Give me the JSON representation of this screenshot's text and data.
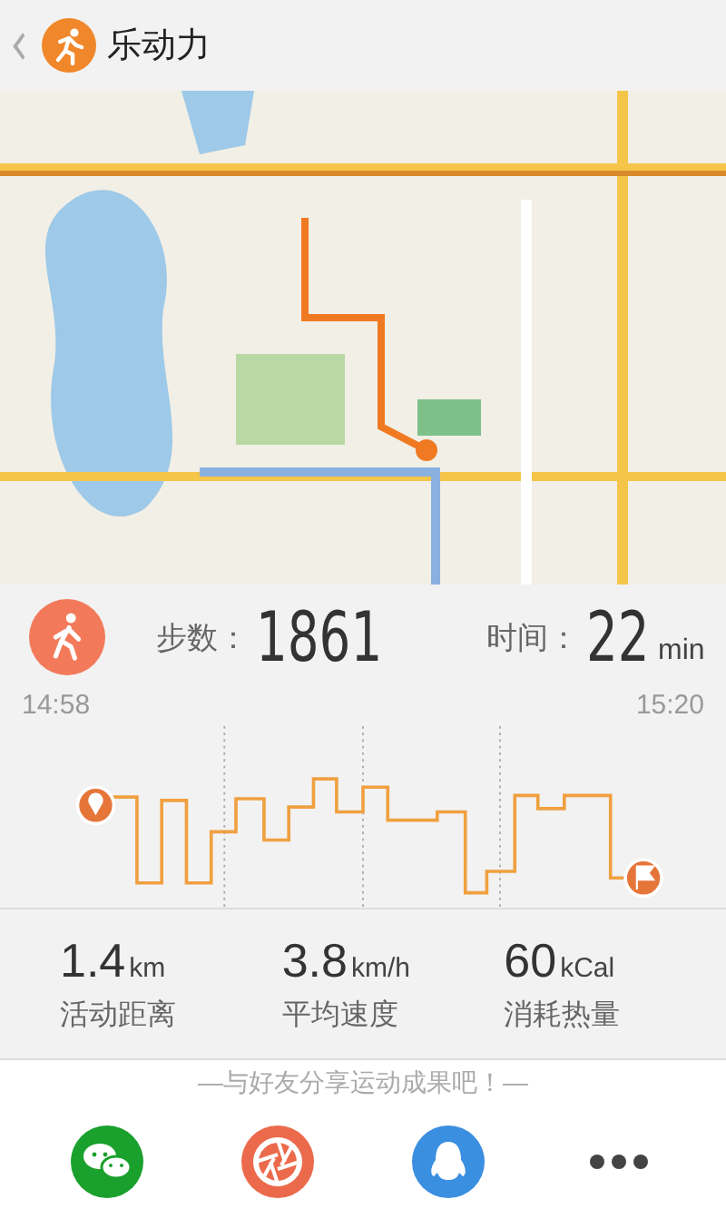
{
  "header": {
    "title": "乐动力"
  },
  "summary": {
    "steps_label": "步数：",
    "steps": "1861",
    "time_label": "时间：",
    "time": "22",
    "time_unit": "min"
  },
  "timeline": {
    "start": "14:58",
    "end": "15:20"
  },
  "stats": [
    {
      "value": "1.4",
      "unit": "km",
      "label": "活动距离"
    },
    {
      "value": "3.8",
      "unit": "km/h",
      "label": "平均速度"
    },
    {
      "value": "60",
      "unit": "kCal",
      "label": "消耗热量"
    }
  ],
  "share": {
    "prompt": "—与好友分享运动成果吧！—",
    "buttons": [
      {
        "kind": "wechat"
      },
      {
        "kind": "camera"
      },
      {
        "kind": "qq"
      },
      {
        "kind": "more"
      }
    ]
  }
}
